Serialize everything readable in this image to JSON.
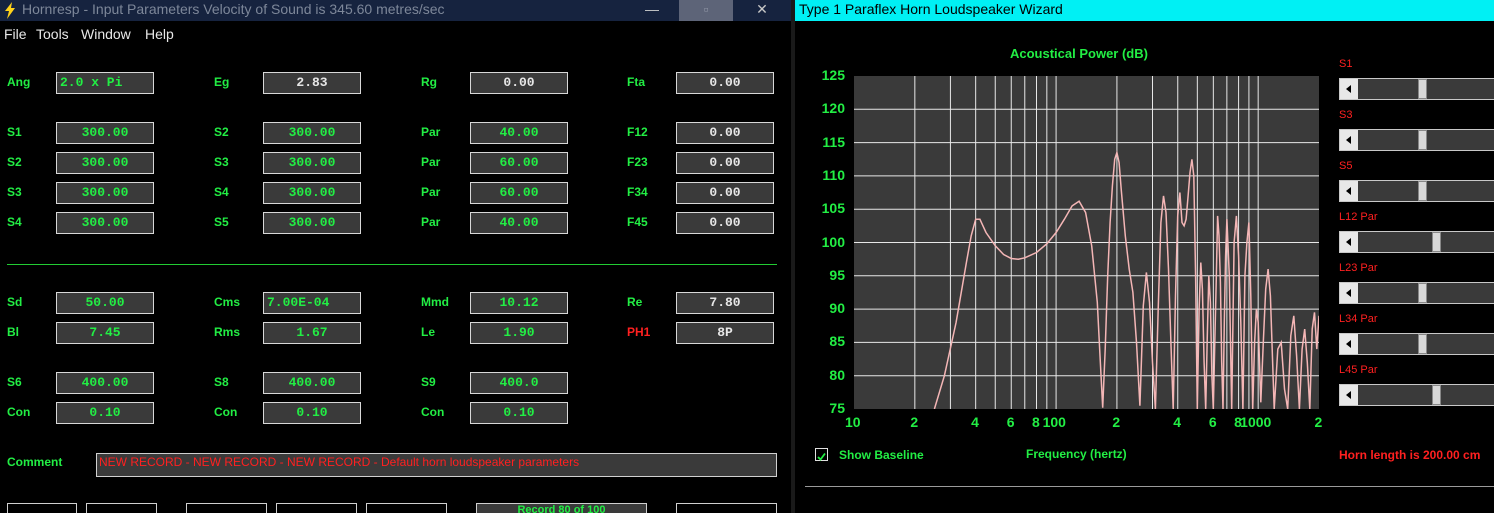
{
  "left_window": {
    "title": "Hornresp - Input Parameters   Velocity of Sound is 345.60 metres/sec",
    "controls": {
      "minimize": "—",
      "maximize": "▫",
      "close": "✕"
    },
    "menu": [
      "File",
      "Tools",
      "Window",
      "Help"
    ],
    "parameters": [
      {
        "label": "Ang",
        "value": "2.0 x Pi"
      },
      {
        "label": "Eg",
        "value": "2.83"
      },
      {
        "label": "Rg",
        "value": "0.00"
      },
      {
        "label": "Fta",
        "value": "0.00"
      },
      {
        "label": "S1",
        "value": "300.00"
      },
      {
        "label": "S2",
        "value": "300.00"
      },
      {
        "label": "Par",
        "value": "40.00"
      },
      {
        "label": "F12",
        "value": "0.00"
      },
      {
        "label": "S2",
        "value": "300.00"
      },
      {
        "label": "S3",
        "value": "300.00"
      },
      {
        "label": "Par",
        "value": "60.00"
      },
      {
        "label": "F23",
        "value": "0.00"
      },
      {
        "label": "S3",
        "value": "300.00"
      },
      {
        "label": "S4",
        "value": "300.00"
      },
      {
        "label": "Par",
        "value": "60.00"
      },
      {
        "label": "F34",
        "value": "0.00"
      },
      {
        "label": "S4",
        "value": "300.00"
      },
      {
        "label": "S5",
        "value": "300.00"
      },
      {
        "label": "Par",
        "value": "40.00"
      },
      {
        "label": "F45",
        "value": "0.00"
      },
      {
        "label": "Sd",
        "value": "50.00"
      },
      {
        "label": "Cms",
        "value": "7.00E-04"
      },
      {
        "label": "Mmd",
        "value": "10.12"
      },
      {
        "label": "Re",
        "value": "7.80"
      },
      {
        "label": "Bl",
        "value": "7.45"
      },
      {
        "label": "Rms",
        "value": "1.67"
      },
      {
        "label": "Le",
        "value": "1.90"
      },
      {
        "label": "PH1",
        "value": "8P"
      },
      {
        "label": "S6",
        "value": "400.00"
      },
      {
        "label": "S8",
        "value": "400.00"
      },
      {
        "label": "S9",
        "value": "400.0"
      },
      {
        "label": "Con",
        "value": "0.10"
      },
      {
        "label": "Con",
        "value": "0.10"
      },
      {
        "label": "Con",
        "value": "0.10"
      }
    ],
    "comment_label": "Comment",
    "comment_text": "NEW RECORD - NEW RECORD - NEW RECORD - Default horn loudspeaker parameters",
    "record_button": "Record 80 of 100",
    "colors": {
      "label": "#22ee44",
      "warning_label": "#ff2020",
      "field_bg": "#3a3a3a"
    }
  },
  "right_window": {
    "title": "Type 1 Paraflex Horn Loudspeaker Wizard",
    "show_baseline_label": "Show Baseline",
    "show_baseline_checked": true,
    "horn_length": "Horn length is 200.00 cm",
    "sliders": [
      {
        "label": "S1",
        "position": 0.46
      },
      {
        "label": "S3",
        "position": 0.46
      },
      {
        "label": "S5",
        "position": 0.46
      },
      {
        "label": "L12 Par",
        "position": 0.56
      },
      {
        "label": "L23 Par",
        "position": 0.46
      },
      {
        "label": "L34 Par",
        "position": 0.46
      },
      {
        "label": "L45 Par",
        "position": 0.56
      }
    ]
  },
  "chart_data": {
    "type": "line",
    "title": "Acoustical Power (dB)",
    "xlabel": "Frequency (hertz)",
    "ylabel": "",
    "xscale": "log",
    "xlim": [
      10,
      2000
    ],
    "ylim": [
      75,
      125
    ],
    "y_ticks": [
      "125",
      "120",
      "115",
      "110",
      "105",
      "100",
      "95",
      "90",
      "85",
      "80",
      "75"
    ],
    "x_ticks": [
      {
        "v": 10,
        "label": "10"
      },
      {
        "v": 20,
        "label": "2"
      },
      {
        "v": 40,
        "label": "4"
      },
      {
        "v": 60,
        "label": "6"
      },
      {
        "v": 80,
        "label": "8"
      },
      {
        "v": 100,
        "label": "100"
      },
      {
        "v": 200,
        "label": "2"
      },
      {
        "v": 400,
        "label": "4"
      },
      {
        "v": 600,
        "label": "6"
      },
      {
        "v": 800,
        "label": "8"
      },
      {
        "v": 1000,
        "label": "1000"
      },
      {
        "v": 2000,
        "label": "2"
      }
    ],
    "grid": true,
    "line_color": "#f4b6b6",
    "series": [
      {
        "x": [
          25,
          28,
          32,
          36,
          38,
          40,
          42,
          45,
          50,
          55,
          60,
          65,
          70,
          80,
          90,
          100,
          110,
          120,
          130,
          140,
          150,
          160,
          165,
          170,
          175,
          180,
          185,
          190,
          195,
          200,
          205,
          210,
          220,
          230,
          240,
          250,
          260,
          270,
          280,
          290,
          300,
          310,
          320,
          330,
          340,
          350,
          360,
          370,
          380,
          390,
          400,
          410,
          420,
          430,
          440,
          450,
          460,
          470,
          480,
          490,
          500,
          510,
          520,
          530,
          540,
          550,
          560,
          570,
          580,
          590,
          600,
          610,
          620,
          630,
          640,
          650,
          660,
          670,
          680,
          690,
          700,
          720,
          740,
          760,
          780,
          800,
          820,
          840,
          860,
          880,
          900,
          920,
          940,
          960,
          980,
          1000,
          1030,
          1060,
          1090,
          1120,
          1150,
          1200,
          1250,
          1300,
          1350,
          1400,
          1450,
          1500,
          1550,
          1600,
          1650,
          1700,
          1750,
          1800,
          1850,
          1900,
          1950,
          2000
        ],
        "y": [
          75,
          80,
          88,
          97,
          101,
          103.5,
          103.5,
          101.5,
          99.5,
          98.2,
          97.6,
          97.5,
          97.7,
          98.5,
          99.8,
          101.5,
          103.5,
          105.5,
          106.2,
          104.5,
          99.5,
          91,
          83,
          75.2,
          84,
          95,
          103,
          108.5,
          112.5,
          113.5,
          112,
          108,
          101,
          96,
          92.5,
          85,
          75.5,
          90.5,
          95.5,
          91,
          82,
          75,
          90,
          103,
          107,
          104.5,
          96,
          85,
          75,
          92,
          104,
          107.5,
          103,
          102.5,
          103.5,
          107,
          110.5,
          112.5,
          110,
          95,
          75,
          90,
          97,
          93,
          82,
          75,
          86,
          95,
          91,
          80,
          75,
          85,
          94,
          104,
          101,
          94,
          82,
          75,
          88,
          98,
          103.5,
          95,
          75,
          100,
          104,
          98,
          88,
          75,
          95,
          100,
          103,
          92,
          75,
          85,
          90,
          88,
          76,
          85,
          93,
          96,
          92,
          75,
          84,
          85,
          78,
          75,
          86,
          89,
          83,
          75,
          84,
          87,
          82,
          75,
          87,
          89.5,
          84,
          89
        ]
      }
    ]
  }
}
